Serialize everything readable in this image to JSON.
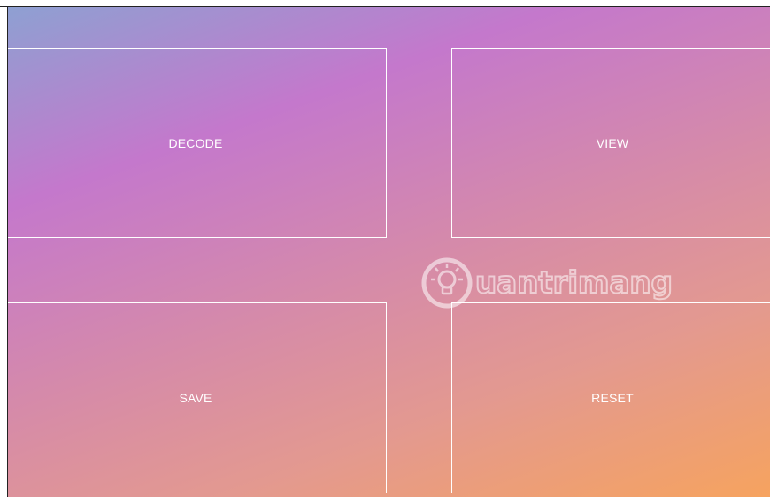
{
  "buttons": {
    "decode": "DECODE",
    "view": "VIEW",
    "save": "SAVE",
    "reset": "RESET"
  },
  "watermark": {
    "text": "uantrimang",
    "icon": "lightbulb-icon"
  },
  "colors": {
    "gradient_start": "#8ea0d2",
    "gradient_mid": "#c478cc",
    "gradient_end": "#f6a35f",
    "tile_border": "#ffffff",
    "text": "#ffffff"
  }
}
